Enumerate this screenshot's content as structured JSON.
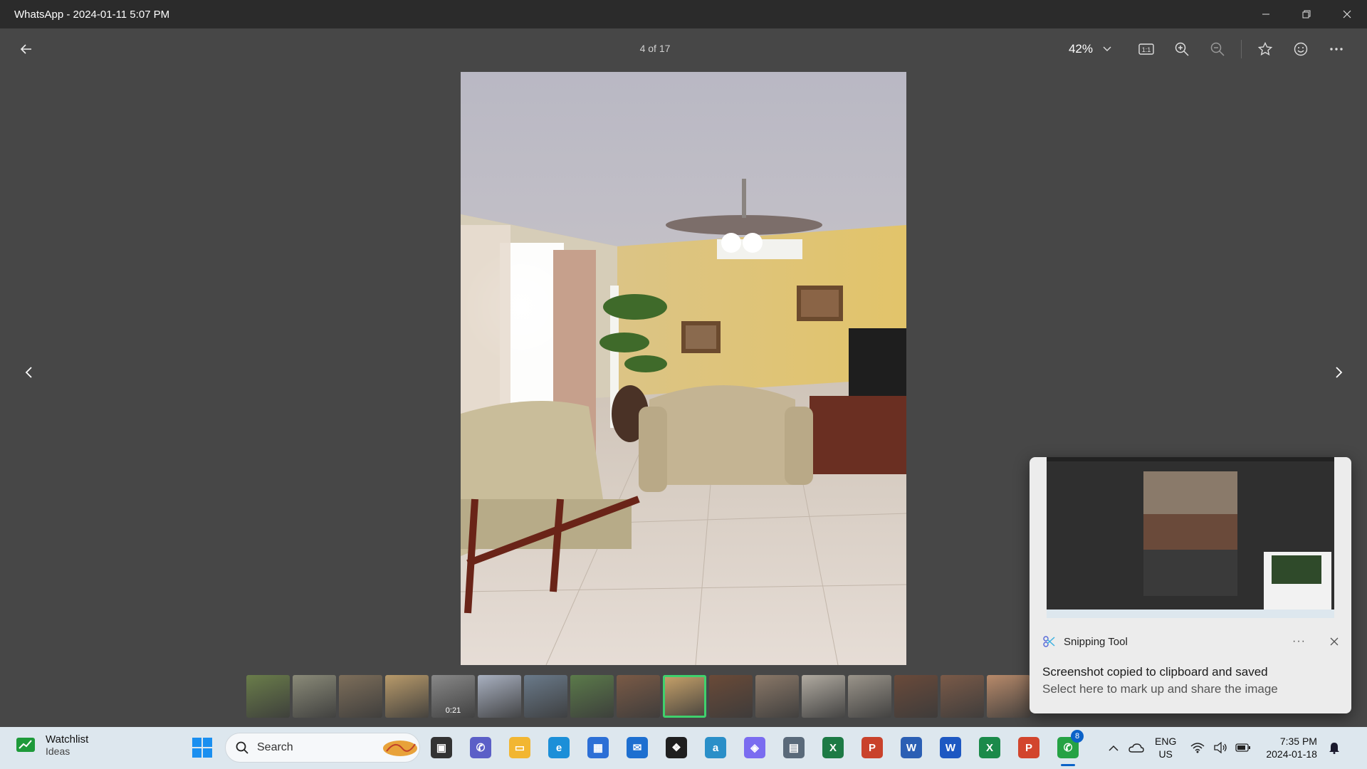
{
  "window": {
    "title": "WhatsApp - 2024-01-11 5:07 PM"
  },
  "viewer": {
    "counter": "4 of 17",
    "zoom": "42%",
    "tools": [
      "actual-size-icon",
      "zoom-in-icon",
      "zoom-out-icon",
      "star-icon",
      "emoji-icon",
      "more-icon"
    ]
  },
  "filmstrip": {
    "video_duration": "0:21",
    "selected_index": 9,
    "thumb_colors": [
      "#6a7d4a",
      "#8a8a78",
      "#7d6e5a",
      "#b89a6a",
      "#888888",
      "#a8b0c0",
      "#6a7a8a",
      "#5b7a4a",
      "#7a5a46",
      "#c9a36a",
      "#6a4a38",
      "#8a7868",
      "#b0aaa0",
      "#9a948a",
      "#6a4a3a",
      "#7a5a48",
      "#b88a6a"
    ]
  },
  "toast": {
    "app": "Snipping Tool",
    "title": "Screenshot copied to clipboard and saved",
    "subtitle": "Select here to mark up and share the image"
  },
  "taskbar": {
    "widget_title": "Watchlist",
    "widget_subtitle": "Ideas",
    "search_placeholder": "Search",
    "whatsapp_badge": "8",
    "apps": [
      {
        "name": "task-view",
        "color": "#333",
        "glyph": "▣"
      },
      {
        "name": "teams",
        "color": "#5b5fc7",
        "glyph": "✆"
      },
      {
        "name": "file-explorer",
        "color": "#f2b632",
        "glyph": "▭"
      },
      {
        "name": "edge",
        "color": "#1c8fd8",
        "glyph": "e"
      },
      {
        "name": "microsoft-store",
        "color": "#2c6fd6",
        "glyph": "▦"
      },
      {
        "name": "mail",
        "color": "#1d6fd0",
        "glyph": "✉"
      },
      {
        "name": "dropbox",
        "color": "#1f1f1f",
        "glyph": "❖"
      },
      {
        "name": "amazon",
        "color": "#2a8fc8",
        "glyph": "a"
      },
      {
        "name": "copilot",
        "color": "#7a6cf0",
        "glyph": "◈"
      },
      {
        "name": "calculator",
        "color": "#5a6a7a",
        "glyph": "▤"
      },
      {
        "name": "excel",
        "color": "#1d7a45",
        "glyph": "X"
      },
      {
        "name": "powerpoint",
        "color": "#c9422b",
        "glyph": "P"
      },
      {
        "name": "word",
        "color": "#2b5fb4",
        "glyph": "W"
      },
      {
        "name": "word-2",
        "color": "#1e58c2",
        "glyph": "W"
      },
      {
        "name": "excel-2",
        "color": "#1b8a4a",
        "glyph": "X"
      },
      {
        "name": "powerpoint-2",
        "color": "#d2452d",
        "glyph": "P"
      },
      {
        "name": "whatsapp",
        "color": "#25a244",
        "glyph": "✆"
      }
    ],
    "lang_1": "ENG",
    "lang_2": "US",
    "time": "7:35 PM",
    "date": "2024-01-18"
  }
}
